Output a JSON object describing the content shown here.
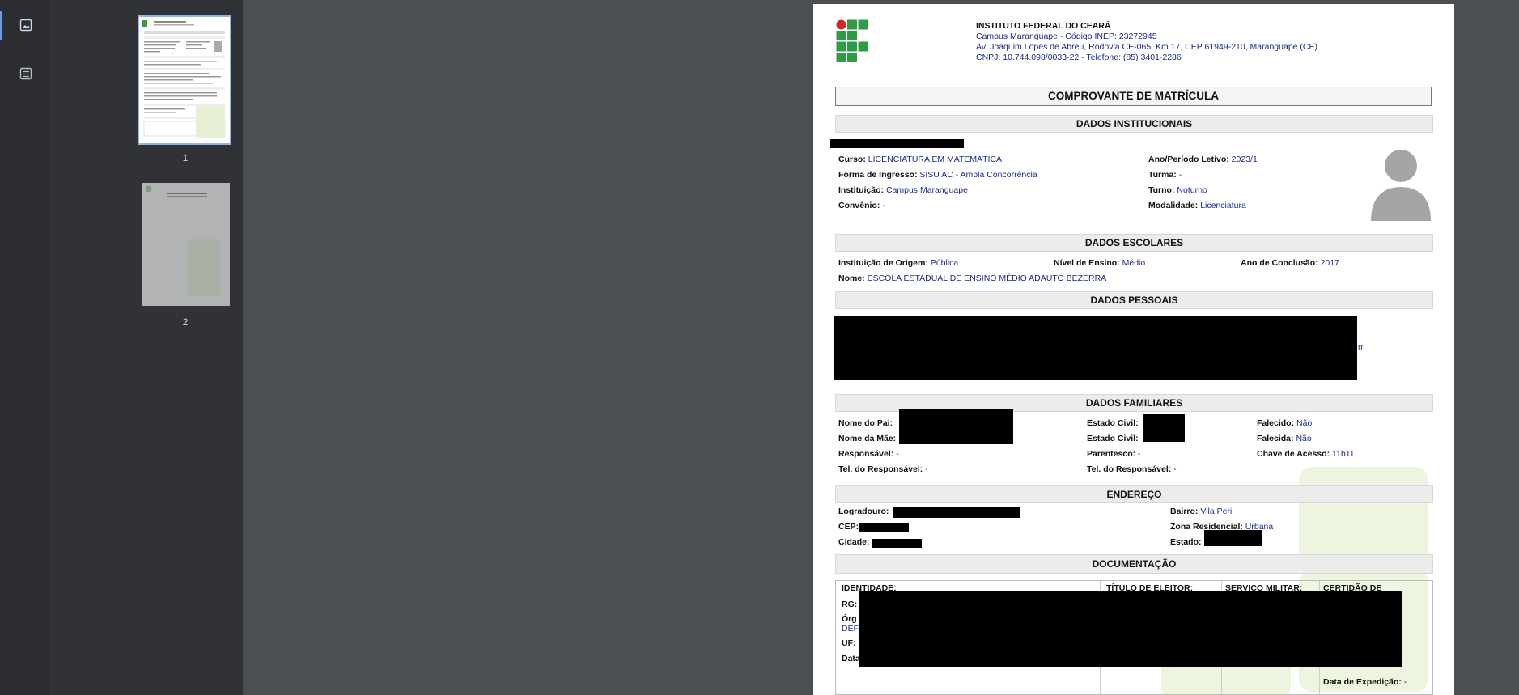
{
  "viewer": {
    "thumbnails": [
      {
        "page_label": "1",
        "selected": true
      },
      {
        "page_label": "2",
        "selected": false
      }
    ],
    "sidebar_icons": [
      "image-thumbnails-icon",
      "document-outline-icon"
    ]
  },
  "document": {
    "header": {
      "institution": "INSTITUTO FEDERAL DO CEARÁ",
      "campus": "Campus Maranguape - Código INEP: 23272945",
      "address": "Av. Joaquim Lopes de Abreu, Rodovia CE-065, Km 17, CEP 61949-210, Maranguape (CE)",
      "contact": "CNPJ: 10.744.098/0033-22 - Telefone: (85) 3401-2286"
    },
    "title": "COMPROVANTE DE MATRÍCULA",
    "institucionais": {
      "heading": "DADOS INSTITUCIONAIS",
      "curso_label": "Curso:",
      "curso": "LICENCIATURA EM MATEMÁTICA",
      "forma_label": "Forma de Ingresso:",
      "forma": "SISU AC - Ampla Concorrência",
      "instituicao_label": "Instituição:",
      "instituicao": "Campus Maranguape",
      "convenio_label": "Convênio:",
      "convenio": "-",
      "ano_label": "Ano/Período Letivo:",
      "ano": "2023/1",
      "turma_label": "Turma:",
      "turma": "-",
      "turno_label": "Turno:",
      "turno": "Noturno",
      "modalidade_label": "Modalidade:",
      "modalidade": "Licenciatura"
    },
    "escolares": {
      "heading": "DADOS ESCOLARES",
      "origem_label": "Instituição de Origem:",
      "origem": "Pública",
      "nivel_label": "Nível de Ensino:",
      "nivel": "Médio",
      "conclusao_label": "Ano de Conclusão:",
      "conclusao": "2017",
      "nome_label": "Nome:",
      "nome": "ESCOLA ESTADUAL DE ENSINO MÉDIO ADAUTO BEZERRA"
    },
    "pessoais": {
      "heading": "DADOS PESSOAIS",
      "email_tail": "m"
    },
    "familiares": {
      "heading": "DADOS FAMILIARES",
      "pai_label": "Nome do Pai:",
      "mae_label": "Nome da Mãe:",
      "responsavel_label": "Responsável:",
      "responsavel": "-",
      "tel_resp_label": "Tel. do Responsável:",
      "tel_resp": "-",
      "estado_civil_label": "Estado Civil:",
      "parentesco_label": "Parentesco:",
      "parentesco": "-",
      "tel_resp2_label": "Tel. do Responsável:",
      "tel_resp2": "-",
      "falecido_label": "Falecido:",
      "falecido": "Não",
      "falecida_label": "Falecida:",
      "falecida": "Não",
      "chave_label": "Chave de Acesso:",
      "chave": "11b11"
    },
    "endereco": {
      "heading": "ENDEREÇO",
      "logradouro_label": "Logradouro:",
      "cep_label": "CEP:",
      "cidade_label": "Cidade:",
      "bairro_label": "Bairro:",
      "bairro": "Vila Peri",
      "zona_label": "Zona Residencial:",
      "zona": "Urbana",
      "estado_label": "Estado:"
    },
    "documentacao": {
      "heading": "DOCUMENTAÇÃO",
      "identidade": "IDENTIDADE:",
      "titulo": "TÍTULO DE ELEITOR:",
      "servico": "SERVIÇO MILITAR:",
      "certidao": "CERTIDÃO DE",
      "rg_label": "RG:",
      "orgao_label": "Órg",
      "def_label": "DEF",
      "uf_label": "UF:",
      "data_label": "Data",
      "expedicao_label": "Data de Expedição:",
      "expedicao": "-"
    }
  }
}
